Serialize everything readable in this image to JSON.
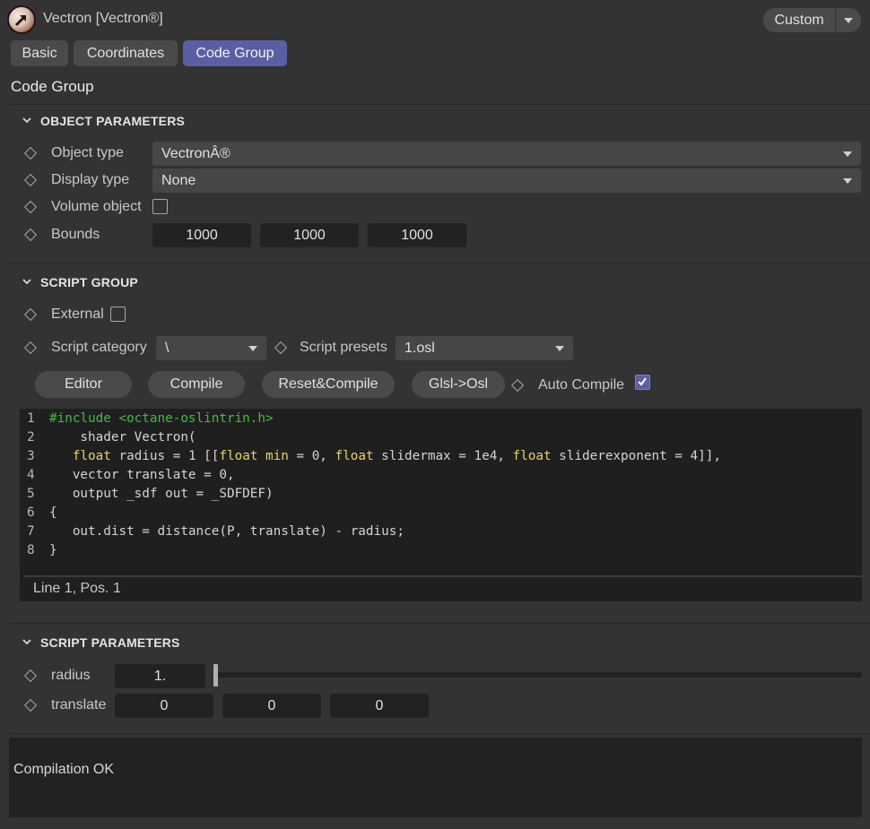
{
  "header": {
    "title": "Vectron [Vectron®]",
    "icon": "vectron-object-icon",
    "layout_button": "Custom"
  },
  "tabs": [
    {
      "label": "Basic",
      "active": false
    },
    {
      "label": "Coordinates",
      "active": false
    },
    {
      "label": "Code Group",
      "active": true
    }
  ],
  "section_title": "Code Group",
  "object_parameters": {
    "heading": "OBJECT PARAMETERS",
    "object_type_label": "Object type",
    "object_type_value": "VectronÂ®",
    "display_type_label": "Display type",
    "display_type_value": "None",
    "volume_object_label": "Volume object",
    "volume_object_checked": false,
    "bounds_label": "Bounds",
    "bounds": [
      "1000",
      "1000",
      "1000"
    ]
  },
  "script_group": {
    "heading": "SCRIPT GROUP",
    "external_label": "External",
    "external_checked": false,
    "script_category_label": "Script category",
    "script_category_value": "\\",
    "script_presets_label": "Script presets",
    "script_presets_value": "1.osl",
    "buttons": {
      "editor": "Editor",
      "compile": "Compile",
      "reset_compile": "Reset&Compile",
      "glsl_osl": "Glsl->Osl"
    },
    "auto_compile_label": "Auto Compile",
    "auto_compile_checked": true
  },
  "editor": {
    "line_numbers": [
      "1",
      "2",
      "3",
      "4",
      "5",
      "6",
      "7",
      "8"
    ],
    "lines": {
      "l1": "#include <octane-oslintrin.h>",
      "l2": "    shader Vectron(",
      "l3_kw1": "float",
      "l3_a": " radius = 1 [[",
      "l3_kw2": "float",
      "l3_kw3": "min",
      "l3_b": " = 0, ",
      "l3_kw4": "float",
      "l3_c": " slidermax = 1e4, ",
      "l3_kw5": "float",
      "l3_d": " sliderexponent = 4]],",
      "l4": "   vector translate = 0,",
      "l5": "   output _sdf out = _SDFDEF)",
      "l6": "{",
      "l7": "   out.dist = distance(P, translate) - radius;",
      "l8": "}"
    },
    "status": "Line 1, Pos. 1"
  },
  "script_parameters": {
    "heading": "SCRIPT PARAMETERS",
    "radius_label": "radius",
    "radius_value": "1.",
    "radius_slider_fraction": 0.0,
    "translate_label": "translate",
    "translate": [
      "0",
      "0",
      "0"
    ]
  },
  "console": {
    "message": "Compilation OK"
  },
  "colors": {
    "background": "#333333",
    "accent": "#5a5fa4",
    "editor_bg": "#1f1f1f",
    "code_include": "#3fbf3f",
    "code_keyword": "#e6d36a"
  }
}
